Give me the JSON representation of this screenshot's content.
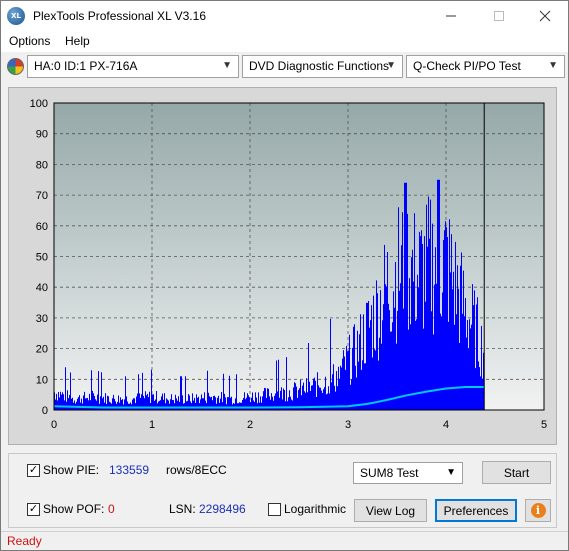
{
  "window": {
    "title": "PlexTools Professional XL V3.16",
    "icon_text": "XL",
    "minimize_icon": "minimize-icon",
    "maximize_icon": "maximize-icon",
    "close_icon": "close-icon"
  },
  "menu": {
    "options": "Options",
    "help": "Help"
  },
  "toolbar": {
    "drive": "HA:0 ID:1  PX-716A",
    "function": "DVD Diagnostic Functions",
    "test": "Q-Check PI/PO Test"
  },
  "chart_data": {
    "type": "area",
    "xlim": [
      0,
      5
    ],
    "ylim": [
      0,
      100
    ],
    "x_ticks": [
      "0",
      "1",
      "2",
      "3",
      "4",
      "5"
    ],
    "y_ticks": [
      "0",
      "10",
      "20",
      "30",
      "40",
      "50",
      "60",
      "70",
      "80",
      "90",
      "100"
    ],
    "grid": true,
    "end_marker_x": 4.39,
    "series": [
      {
        "color": "#0000ff",
        "style": "bars",
        "x": [
          0.0,
          0.2,
          0.4,
          0.6,
          0.8,
          1.0,
          1.2,
          1.4,
          1.6,
          1.8,
          2.0,
          2.2,
          2.4,
          2.6,
          2.8,
          2.9,
          3.0,
          3.1,
          3.2,
          3.3,
          3.4,
          3.5,
          3.6,
          3.7,
          3.8,
          3.9,
          4.0,
          4.1,
          4.2,
          4.3,
          4.39
        ],
        "values": [
          8,
          5,
          6,
          5,
          5,
          6,
          5,
          5,
          6,
          5,
          6,
          7,
          8,
          10,
          13,
          16,
          22,
          28,
          37,
          45,
          56,
          62,
          66,
          60,
          64,
          68,
          66,
          55,
          44,
          36,
          25
        ],
        "peaks": [
          {
            "x": 3.58,
            "y": 74
          },
          {
            "x": 3.92,
            "y": 75
          }
        ]
      },
      {
        "color": "#00c8ff",
        "style": "line",
        "x": [
          0.0,
          0.5,
          1.0,
          1.5,
          2.0,
          2.5,
          3.0,
          3.2,
          3.4,
          3.6,
          3.8,
          4.0,
          4.2,
          4.39
        ],
        "values": [
          1.2,
          0.8,
          0.8,
          0.8,
          0.8,
          0.9,
          1.2,
          2.0,
          3.3,
          4.8,
          6.0,
          7.0,
          7.5,
          7.5
        ]
      }
    ]
  },
  "controls": {
    "show_pie_label": "Show PIE:",
    "pie_value": "133559",
    "pie_unit": "rows/8ECC",
    "show_pof_label": "Show POF:",
    "pof_value": "0",
    "lsn_label": "LSN:",
    "lsn_value": "2298496",
    "logarithmic_label": "Logarithmic",
    "sum_test": "SUM8 Test",
    "start_label": "Start",
    "view_log_label": "View Log",
    "preferences_label": "Preferences",
    "info_icon": "info-icon",
    "show_pie_checked": "✓",
    "show_pof_checked": "✓"
  },
  "status": {
    "text": "Ready"
  },
  "colors": {
    "plot_bg_top": "#9aabab",
    "pie_color": "#0000ff",
    "pof_line": "#00c8ff",
    "status_text": "#d01010"
  }
}
